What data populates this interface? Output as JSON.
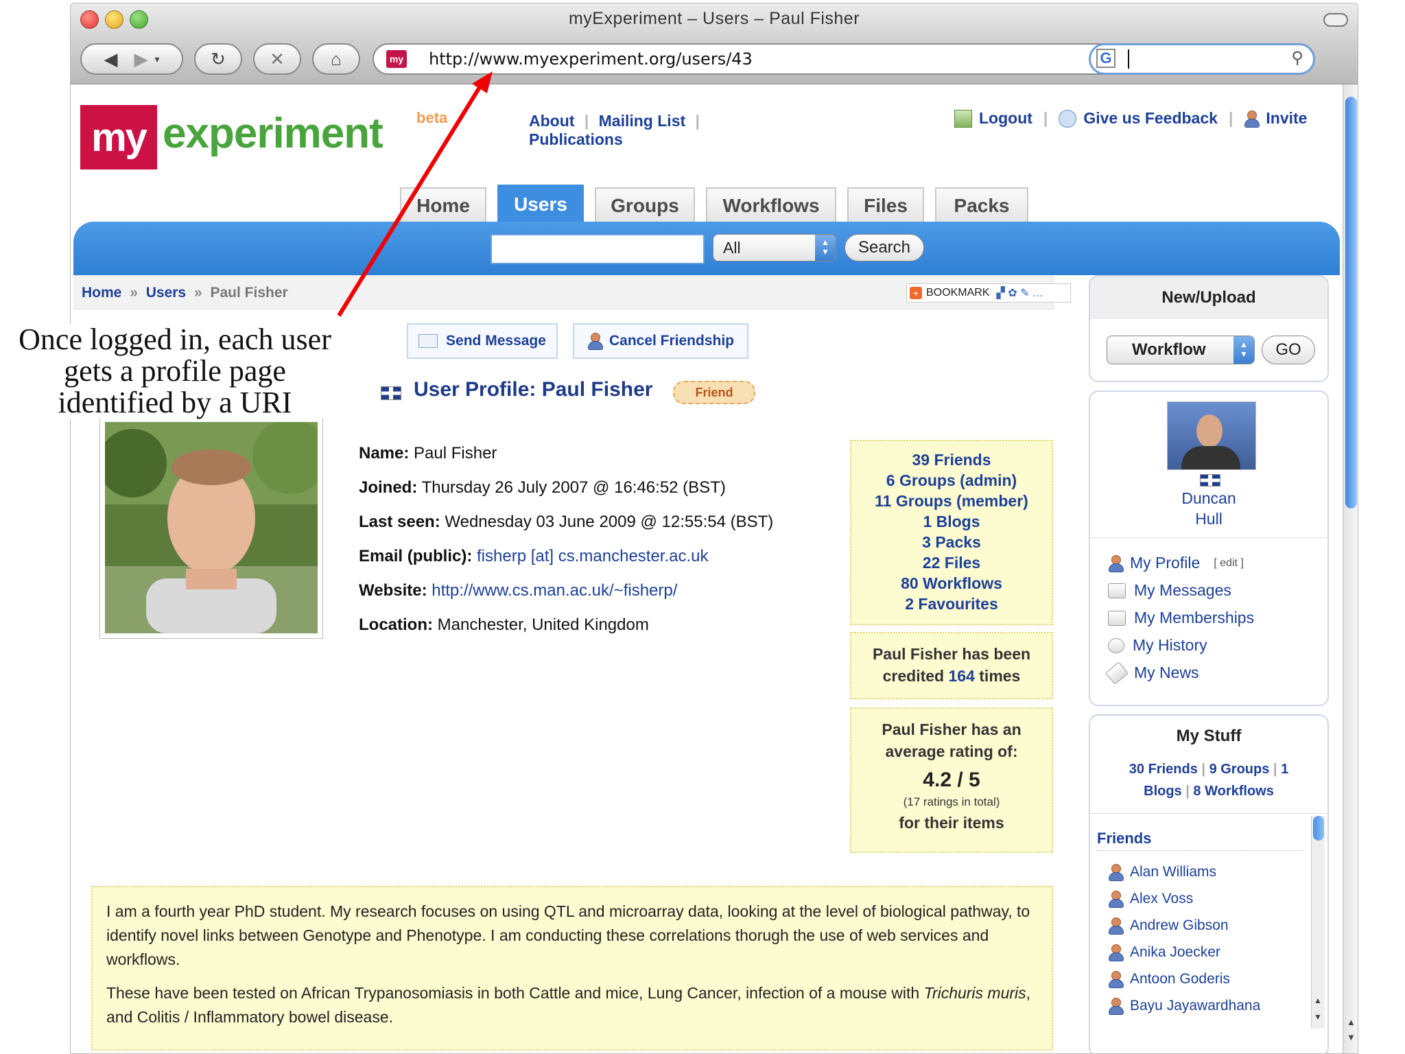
{
  "browser": {
    "window_title": "myExperiment – Users – Paul Fisher",
    "url": "http://www.myexperiment.org/users/43",
    "site_badge": "my",
    "search_engine_badge": "G"
  },
  "site": {
    "logo_my": "my",
    "logo_experiment": "experiment",
    "logo_beta": "beta",
    "top_links": {
      "about": "About",
      "mailing_list": "Mailing List",
      "publications": "Publications"
    },
    "account_links": {
      "logout": "Logout",
      "feedback": "Give us Feedback",
      "invite": "Invite"
    },
    "tabs": [
      {
        "label": "Home"
      },
      {
        "label": "Users"
      },
      {
        "label": "Groups"
      },
      {
        "label": "Workflows"
      },
      {
        "label": "Files"
      },
      {
        "label": "Packs"
      }
    ],
    "search": {
      "value": "",
      "scope": "All",
      "button": "Search"
    }
  },
  "breadcrumb": {
    "home": "Home",
    "sep": "»",
    "users": "Users",
    "current": "Paul Fisher",
    "bookmark": "BOOKMARK"
  },
  "actions": {
    "send_message": "Send Message",
    "cancel_friendship": "Cancel Friendship"
  },
  "profile": {
    "heading": "User Profile: Paul Fisher",
    "friend_badge": "Friend",
    "name_label": "Name:",
    "name": "Paul Fisher",
    "joined_label": "Joined:",
    "joined": "Thursday 26 July 2007 @ 16:46:52 (BST)",
    "last_seen_label": "Last seen:",
    "last_seen": "Wednesday 03 June 2009 @ 12:55:54 (BST)",
    "email_label": "Email (public):",
    "email": "fisherp [at] cs.manchester.ac.uk",
    "website_label": "Website:",
    "website": "http://www.cs.man.ac.uk/~fisherp/",
    "location_label": "Location:",
    "location": "Manchester, United Kingdom",
    "bio_p1": "I am a fourth year PhD student. My research focuses on using QTL and microarray data, looking at the level of biological pathway, to identify novel links between Genotype and Phenotype. I am conducting these correlations thorugh the use of web services and workflows.",
    "bio_p2_a": "These have been tested on African Trypanosomiasis in both Cattle and mice, Lung Cancer, infection of a mouse with ",
    "bio_p2_italic": "Trichuris muris",
    "bio_p2_b": ", and Colitis / Inflammatory bowel disease."
  },
  "stats": [
    "39 Friends",
    "6 Groups (admin)",
    "11 Groups (member)",
    "1 Blogs",
    "3 Packs",
    "22 Files",
    "80 Workflows",
    "2 Favourites"
  ],
  "credited": {
    "line1": "Paul Fisher has been",
    "line2_a": "credited ",
    "count": "164",
    "line2_b": " times"
  },
  "rating": {
    "line1": "Paul Fisher has an",
    "line2": "average rating of:",
    "score": "4.2 / 5",
    "total": "(17 ratings in total)",
    "line3": "for their items"
  },
  "sidebar": {
    "new_upload_title": "New/Upload",
    "upload_type": "Workflow",
    "go": "GO",
    "current_user_first": "Duncan",
    "current_user_last": "Hull",
    "menu": [
      {
        "label": "My Profile"
      },
      {
        "label": "My Messages"
      },
      {
        "label": "My Memberships"
      },
      {
        "label": "My History"
      },
      {
        "label": "My News"
      }
    ],
    "edit": "[ edit ]",
    "my_stuff_title": "My Stuff",
    "my_stuff": {
      "friends": "30 Friends",
      "groups": "9 Groups",
      "blogs_num": "1",
      "blogs": "Blogs",
      "workflows": "8 Workflows",
      "sep": "|"
    },
    "friends_title": "Friends",
    "friends": [
      "Alan Williams",
      "Alex Voss",
      "Andrew Gibson",
      "Anika Joecker",
      "Antoon Goderis",
      "Bayu Jayawardhana"
    ]
  },
  "annotation": {
    "line1": "Once logged in, each user",
    "line2": "gets a profile page",
    "line3": "identified by a URI",
    "arrow_color": "#f00000"
  }
}
